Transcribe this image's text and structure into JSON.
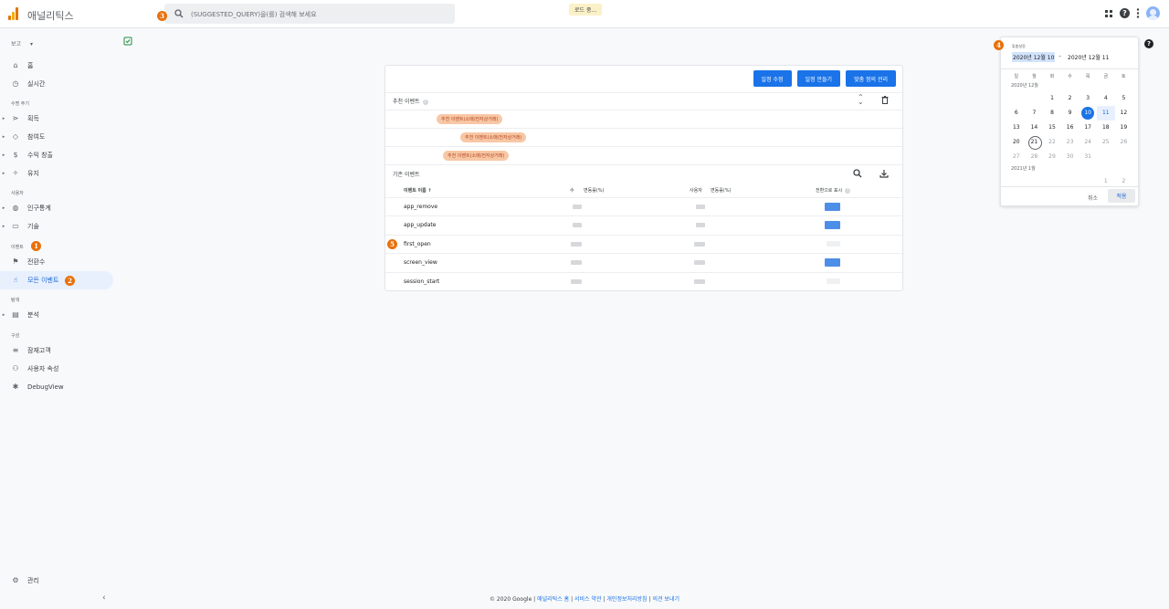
{
  "app": {
    "title": "애널리틱스"
  },
  "search": {
    "placeholder": "(SUGGESTED_QUERY)을(를) 검색해 보세요"
  },
  "loading": "로드 중...",
  "callouts": {
    "one": "1",
    "two": "2",
    "three": "3",
    "four": "4",
    "five": "5"
  },
  "sidebar": {
    "report": "보고",
    "sections": {
      "lifecycle": "수명 주기",
      "user": "사용자",
      "event": "이벤트",
      "explore": "탐색",
      "configure": "구성"
    },
    "items": {
      "home": "홈",
      "realtime": "실시간",
      "acquisition": "획득",
      "engagement": "참여도",
      "monetization": "수익 창출",
      "retention": "유지",
      "demographics": "인구통계",
      "tech": "기술",
      "conversions": "전환수",
      "all_events": "모든 이벤트",
      "analysis": "분석",
      "audiences": "잠재고객",
      "user_properties": "사용자 속성",
      "debugview": "DebugView",
      "admin": "관리"
    }
  },
  "card": {
    "buttons": {
      "edit": "일정 수정",
      "create": "일정 만들기",
      "manage": "맞춤 정의 관리"
    },
    "recommended_title": "추천 이벤트",
    "chips": [
      "추천 이벤트(소매/전자상거래)",
      "추천 이벤트(소매/전자상거래)",
      "추천 이벤트(소매/전자상거래)"
    ],
    "existing_title": "기존 이벤트",
    "headers": {
      "name": "이벤트 이름 ↑",
      "count": "수",
      "count_change": "변동률(%)",
      "users": "사용자",
      "users_change": "변동률(%)",
      "conversion": "전환으로 표시"
    },
    "rows": [
      {
        "name": "app_remove",
        "conversion": true
      },
      {
        "name": "app_update",
        "conversion": true
      },
      {
        "name": "first_open",
        "conversion": false
      },
      {
        "name": "screen_view",
        "conversion": true
      },
      {
        "name": "session_start",
        "conversion": false
      }
    ]
  },
  "calendar": {
    "label": "맞춤설정",
    "start": "2020년 12월 10",
    "separator": "–",
    "end": "2020년 12월 11",
    "weekdays": [
      "일",
      "월",
      "화",
      "수",
      "목",
      "금",
      "토"
    ],
    "month1": "2020년 12월",
    "days1": [
      {
        "d": "",
        "s": ""
      },
      {
        "d": "",
        "s": ""
      },
      {
        "d": "1",
        "s": ""
      },
      {
        "d": "2",
        "s": ""
      },
      {
        "d": "3",
        "s": ""
      },
      {
        "d": "4",
        "s": ""
      },
      {
        "d": "5",
        "s": ""
      },
      {
        "d": "6",
        "s": ""
      },
      {
        "d": "7",
        "s": ""
      },
      {
        "d": "8",
        "s": ""
      },
      {
        "d": "9",
        "s": ""
      },
      {
        "d": "10",
        "s": "sel"
      },
      {
        "d": "11",
        "s": "rng"
      },
      {
        "d": "12",
        "s": ""
      },
      {
        "d": "13",
        "s": ""
      },
      {
        "d": "14",
        "s": ""
      },
      {
        "d": "15",
        "s": ""
      },
      {
        "d": "16",
        "s": ""
      },
      {
        "d": "17",
        "s": ""
      },
      {
        "d": "18",
        "s": ""
      },
      {
        "d": "19",
        "s": ""
      },
      {
        "d": "20",
        "s": ""
      },
      {
        "d": "21",
        "s": "tod"
      },
      {
        "d": "22",
        "s": "dim"
      },
      {
        "d": "23",
        "s": "dim"
      },
      {
        "d": "24",
        "s": "dim"
      },
      {
        "d": "25",
        "s": "dim"
      },
      {
        "d": "26",
        "s": "dim"
      },
      {
        "d": "27",
        "s": "dim"
      },
      {
        "d": "28",
        "s": "dim"
      },
      {
        "d": "29",
        "s": "dim"
      },
      {
        "d": "30",
        "s": "dim"
      },
      {
        "d": "31",
        "s": "dim"
      },
      {
        "d": "",
        "s": ""
      },
      {
        "d": "",
        "s": ""
      }
    ],
    "month2": "2021년 1월",
    "days2": [
      {
        "d": "",
        "s": ""
      },
      {
        "d": "",
        "s": ""
      },
      {
        "d": "",
        "s": ""
      },
      {
        "d": "",
        "s": ""
      },
      {
        "d": "",
        "s": ""
      },
      {
        "d": "1",
        "s": "dim"
      },
      {
        "d": "2",
        "s": "dim"
      }
    ],
    "cancel": "취소",
    "apply": "적용"
  },
  "footer": {
    "copyright": "© 2020 Google |",
    "home": "애널리틱스 홈",
    "terms": "서비스 약관",
    "privacy": "개인정보처리방침",
    "feedback": "의견 보내기",
    "sep": "|"
  }
}
